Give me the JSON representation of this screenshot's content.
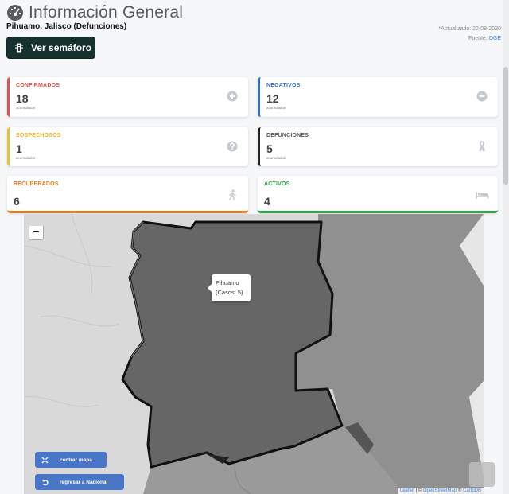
{
  "header": {
    "title": "Información General",
    "subtitle": "Pihuamo, Jalisco (Defunciones)",
    "updated": "*Actualizado: 22-09-2020",
    "source_label": "Fuente:",
    "source_link": "DGE",
    "semaforo_button": "Ver semáforo"
  },
  "cards": {
    "confirmados": {
      "label": "CONFIRMADOS",
      "value": "18",
      "sub": "acumulados",
      "color": "#d9534f",
      "icon": "plus-circle-icon"
    },
    "negativos": {
      "label": "NEGATIVOS",
      "value": "12",
      "sub": "acumulados",
      "color": "#3a6ec1",
      "icon": "minus-circle-icon"
    },
    "sospechosos": {
      "label": "SOSPECHOSOS",
      "value": "1",
      "sub": "acumulados",
      "color": "#e8c13a",
      "icon": "question-circle-icon"
    },
    "defunciones": {
      "label": "DEFUNCIONES",
      "value": "5",
      "sub": "acumulados",
      "color": "#222222",
      "icon": "ribbon-icon"
    },
    "recuperados": {
      "label": "RECUPERADOS",
      "value": "6",
      "color": "#ea7e22",
      "icon": "walking-icon"
    },
    "activos": {
      "label": "ACTIVOS",
      "value": "4",
      "color": "#2fa44a",
      "icon": "bed-icon"
    }
  },
  "map": {
    "zoom_out": "−",
    "tooltip_name": "Pihuamo",
    "tooltip_cases": "(Casos: 5)",
    "center_button": "centrar mapa",
    "back_button": "regresar a Nacional",
    "attribution": {
      "leaflet": "Leaflet",
      "separator": " | © ",
      "osm": "OpenStreetMap",
      "and": " © ",
      "carto": "CartoDB"
    }
  }
}
